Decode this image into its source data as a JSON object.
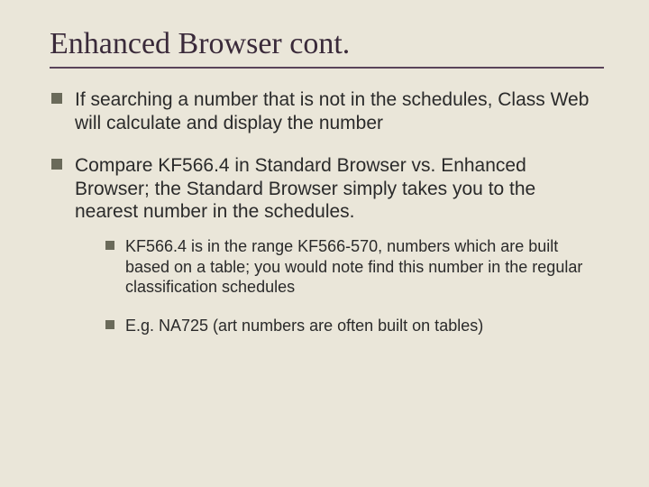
{
  "title": "Enhanced Browser cont.",
  "bullets": [
    {
      "text": " If searching a number that is not in the schedules, Class Web will calculate and display the number"
    },
    {
      "text": "Compare KF566.4 in Standard Browser vs. Enhanced Browser; the Standard Browser simply takes you to the nearest number in the schedules.",
      "sub": [
        {
          "text": "KF566.4 is in the range KF566-570, numbers which are built based on a table; you would note find this number in the regular classification schedules"
        },
        {
          "text": "E.g. NA725 (art numbers are often built on tables)"
        }
      ]
    }
  ]
}
